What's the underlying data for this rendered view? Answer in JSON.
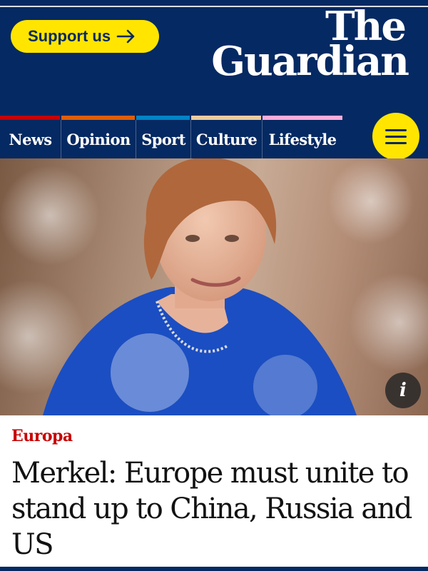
{
  "header": {
    "support_button": {
      "label": "Support us",
      "icon": "arrow-right-icon"
    },
    "logo": {
      "line1": "The",
      "line2": "Guardian"
    },
    "menu_button": {
      "icon": "hamburger-menu-icon"
    },
    "colors": {
      "background": "#052962",
      "accent": "#ffe500"
    }
  },
  "nav": {
    "items": [
      {
        "label": "News",
        "color": "#c70000"
      },
      {
        "label": "Opinion",
        "color": "#e05e00"
      },
      {
        "label": "Sport",
        "color": "#0084c6"
      },
      {
        "label": "Culture",
        "color": "#eacca0"
      },
      {
        "label": "Lifestyle",
        "color": "#ffabdb"
      }
    ]
  },
  "hero": {
    "info_button": {
      "label": "i",
      "icon": "info-icon"
    }
  },
  "article": {
    "kicker": "Europa",
    "headline": "Merkel: Europe must unite to stand up to China, Russia and US",
    "kicker_color": "#c70000"
  }
}
